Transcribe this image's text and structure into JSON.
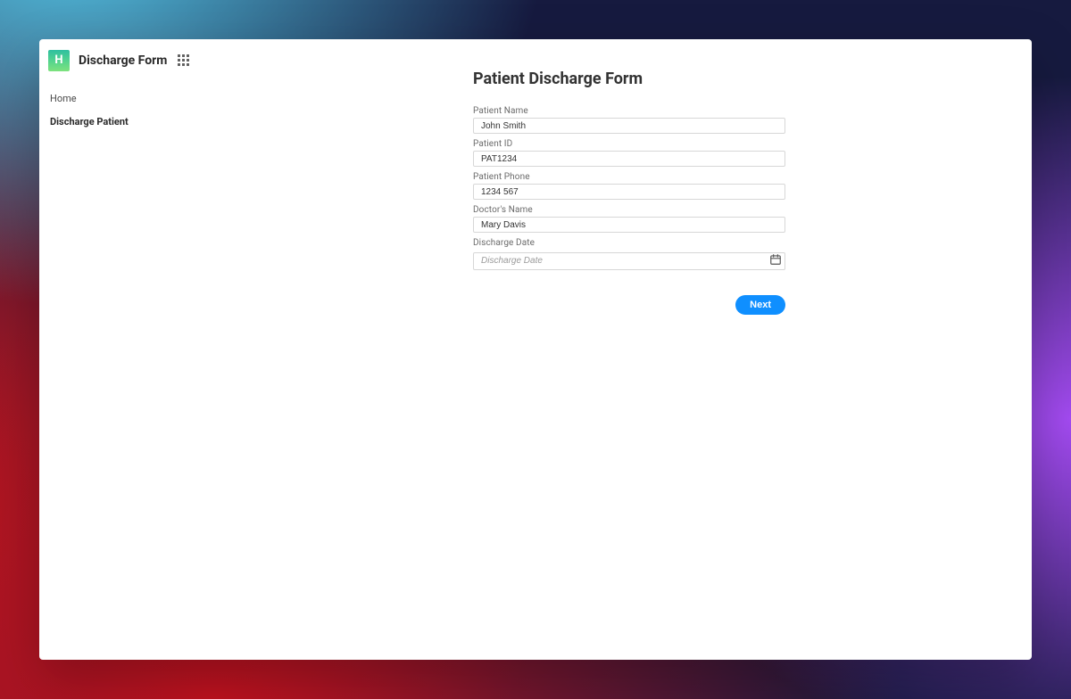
{
  "brand": {
    "logo_letter": "H",
    "title": "Discharge Form"
  },
  "sidebar": {
    "items": [
      {
        "label": "Home",
        "selected": false
      },
      {
        "label": "Discharge Patient",
        "selected": true
      }
    ]
  },
  "page": {
    "title": "Patient Discharge Form",
    "fields": {
      "patient_name": {
        "label": "Patient Name",
        "value": "John Smith"
      },
      "patient_id": {
        "label": "Patient ID",
        "value": "PAT1234"
      },
      "patient_phone": {
        "label": "Patient Phone",
        "value": "1234 567"
      },
      "doctor_name": {
        "label": "Doctor's Name",
        "value": "Mary Davis"
      },
      "discharge_date": {
        "label": "Discharge Date",
        "placeholder": "Discharge Date",
        "value": ""
      }
    },
    "actions": {
      "next_label": "Next"
    }
  },
  "colors": {
    "accent": "#0f8fff",
    "brand_gradient": [
      "#2fbfa0",
      "#53d38f",
      "#7de27e"
    ]
  }
}
